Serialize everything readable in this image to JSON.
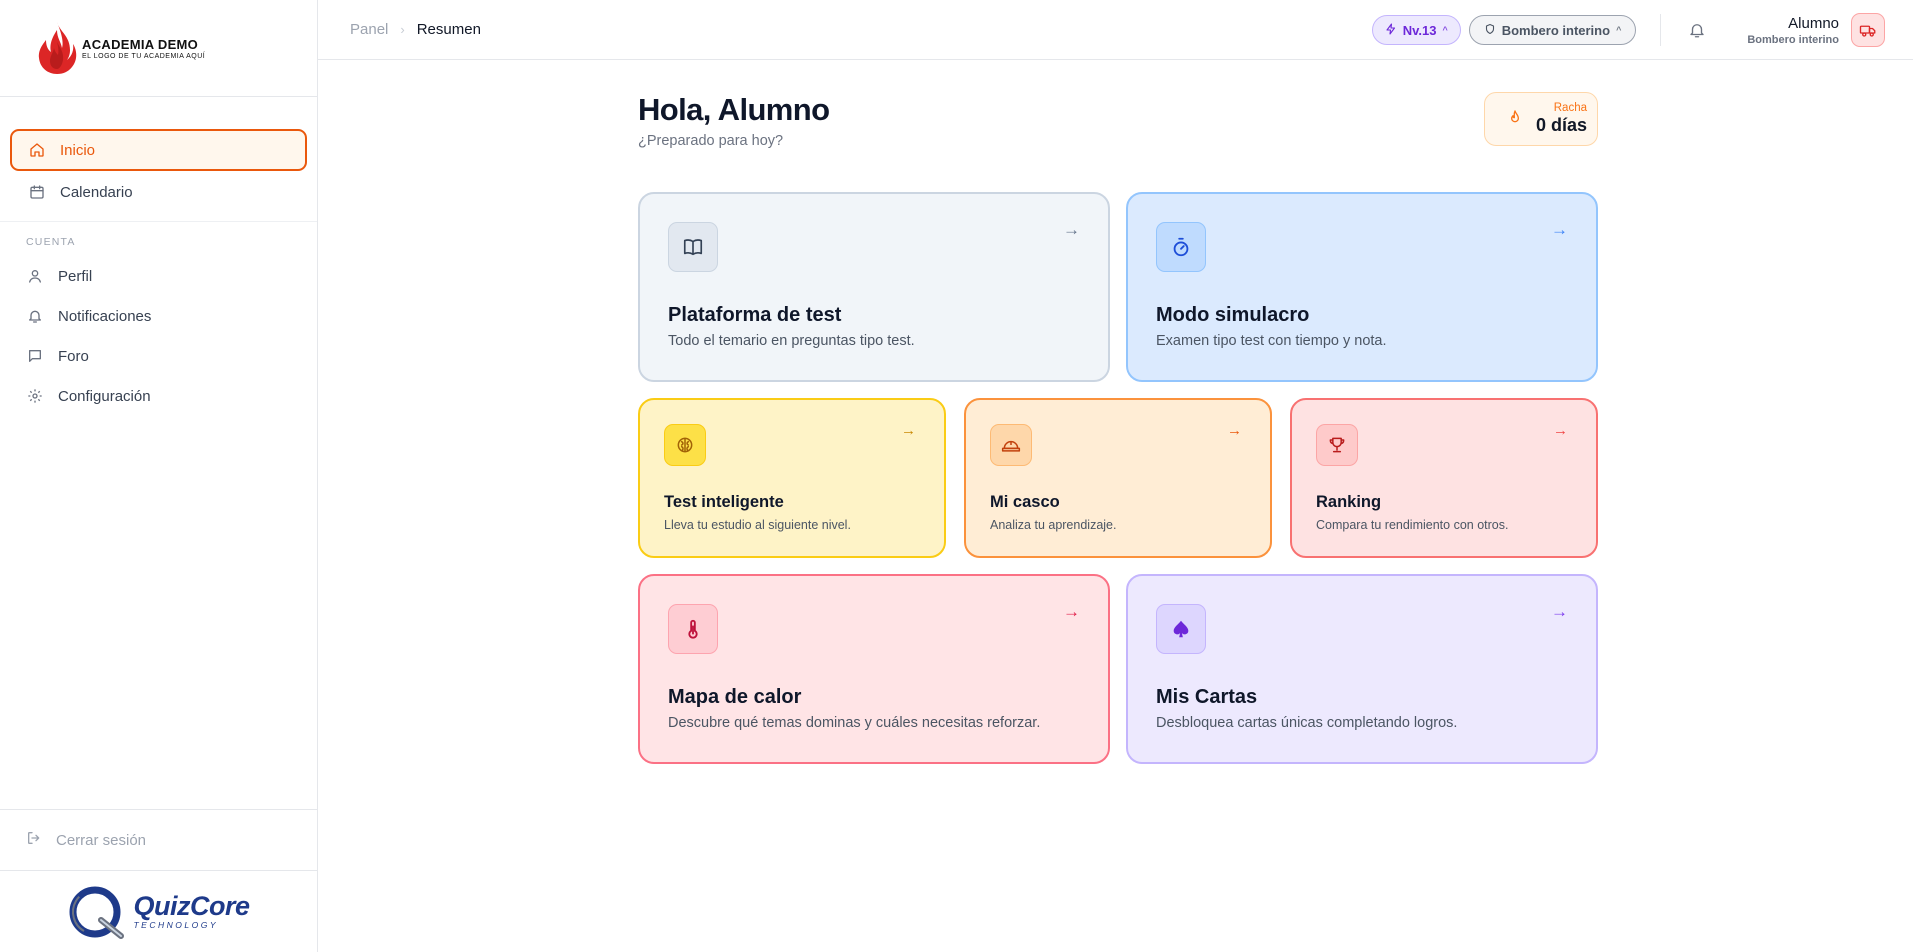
{
  "sidebar": {
    "logo": {
      "title": "ACADEMIA DEMO",
      "subtitle": "EL LOGO DE TU ACADEMIA AQUÍ"
    },
    "nav": [
      {
        "label": "Inicio",
        "icon": "home-icon",
        "active": true
      },
      {
        "label": "Calendario",
        "icon": "calendar-icon"
      }
    ],
    "section_label": "CUENTA",
    "account": [
      {
        "label": "Perfil",
        "icon": "user-icon"
      },
      {
        "label": "Notificaciones",
        "icon": "bell-icon"
      },
      {
        "label": "Foro",
        "icon": "chat-icon"
      },
      {
        "label": "Configuración",
        "icon": "gear-icon"
      }
    ],
    "logout_label": "Cerrar sesión",
    "footer_logo": {
      "name": "QuizCore",
      "sub": "TECHNOLOGY"
    }
  },
  "topbar": {
    "breadcrumb": [
      "Panel",
      "Resumen"
    ],
    "level": "Nv.13",
    "role_selector": "Bombero interino",
    "user": {
      "name": "Alumno",
      "role": "Bombero interino"
    }
  },
  "main": {
    "greeting": "Hola, Alumno",
    "subtitle": "¿Preparado para hoy?",
    "streak": {
      "label": "Racha",
      "value": "0 días"
    },
    "cards": [
      {
        "title": "Plataforma de test",
        "desc": "Todo el temario en preguntas tipo test.",
        "icon": "book-icon"
      },
      {
        "title": "Modo simulacro",
        "desc": "Examen tipo test con tiempo y nota.",
        "icon": "stopwatch-icon"
      },
      {
        "title": "Test inteligente",
        "desc": "Lleva tu estudio al siguiente nivel.",
        "icon": "brain-icon"
      },
      {
        "title": "Mi casco",
        "desc": "Analiza tu aprendizaje.",
        "icon": "helmet-icon"
      },
      {
        "title": "Ranking",
        "desc": "Compara tu rendimiento con otros.",
        "icon": "trophy-icon"
      },
      {
        "title": "Mapa de calor",
        "desc": "Descubre qué temas dominas y cuáles necesitas reforzar.",
        "icon": "thermometer-icon"
      },
      {
        "title": "Mis Cartas",
        "desc": "Desbloquea cartas únicas completando logros.",
        "icon": "spade-icon"
      }
    ]
  },
  "colors": {
    "accent": "#ea580c",
    "slate": "#f1f5f9",
    "blue": "#dbeafe",
    "yellow": "#fef3c7",
    "orange": "#ffedd5",
    "red": "#fee2e2",
    "pink": "#ffe4e6",
    "violet": "#ede9fe"
  }
}
